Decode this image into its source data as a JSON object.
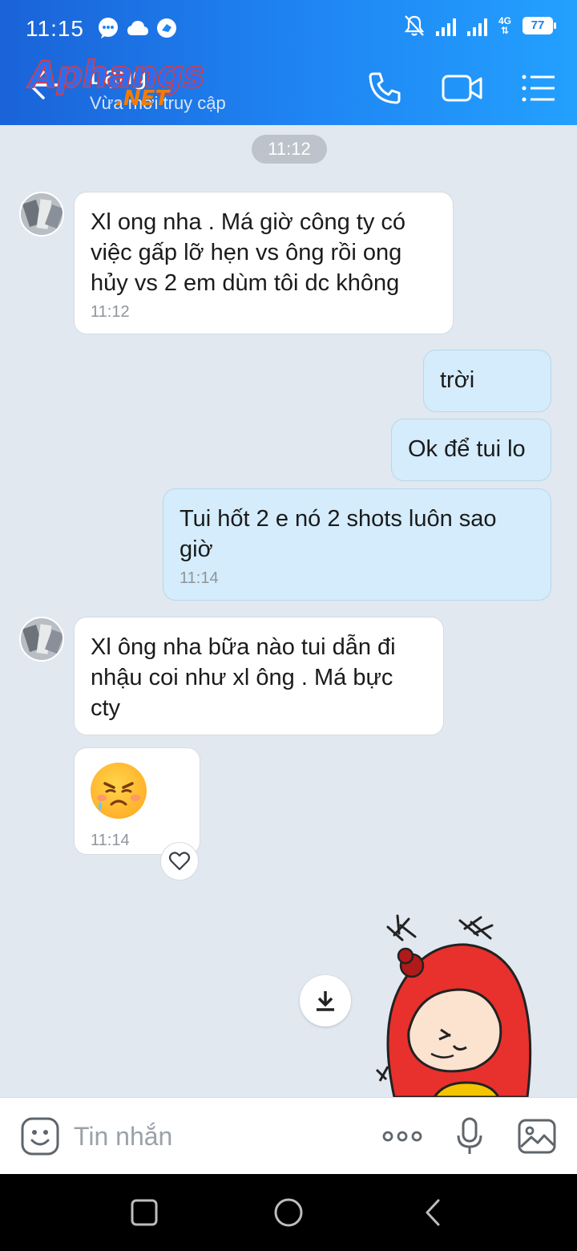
{
  "status_bar": {
    "time": "11:15",
    "network_type": "4G",
    "battery": "77",
    "icons": [
      "messenger-icon",
      "cloud-icon",
      "zalo-icon",
      "alarm-off-icon",
      "signal-icon",
      "signal-icon",
      "battery-icon"
    ]
  },
  "header": {
    "contact_name": "Lạng",
    "contact_status": "Vừa mới truy cập",
    "watermark_main": "Aphangs",
    "watermark_sub": ".NET",
    "accent_color": "#1f86f3"
  },
  "chat": {
    "time_divider": "11:12",
    "messages": [
      {
        "direction": "in",
        "text": "Xl ong nha . Má giờ công ty có việc gấp lỡ hẹn vs ông rồi ong hủy vs 2 em dùm tôi dc không",
        "time": "11:12"
      },
      {
        "direction": "out",
        "text": "trời"
      },
      {
        "direction": "out",
        "text": "Ok để tui lo"
      },
      {
        "direction": "out",
        "text": "Tui hốt 2 e nó 2 shots luôn sao giờ",
        "time": "11:14"
      },
      {
        "direction": "in",
        "text": "Xl ông nha bữa nào tui dẫn đi nhậu coi như xl ông . Má bực cty"
      },
      {
        "direction": "in",
        "emoji": "crying-angry-face",
        "time": "11:14"
      }
    ]
  },
  "composer": {
    "placeholder": "Tin nhắn"
  },
  "navbar": {
    "buttons": [
      "recent-apps",
      "home",
      "back"
    ]
  }
}
